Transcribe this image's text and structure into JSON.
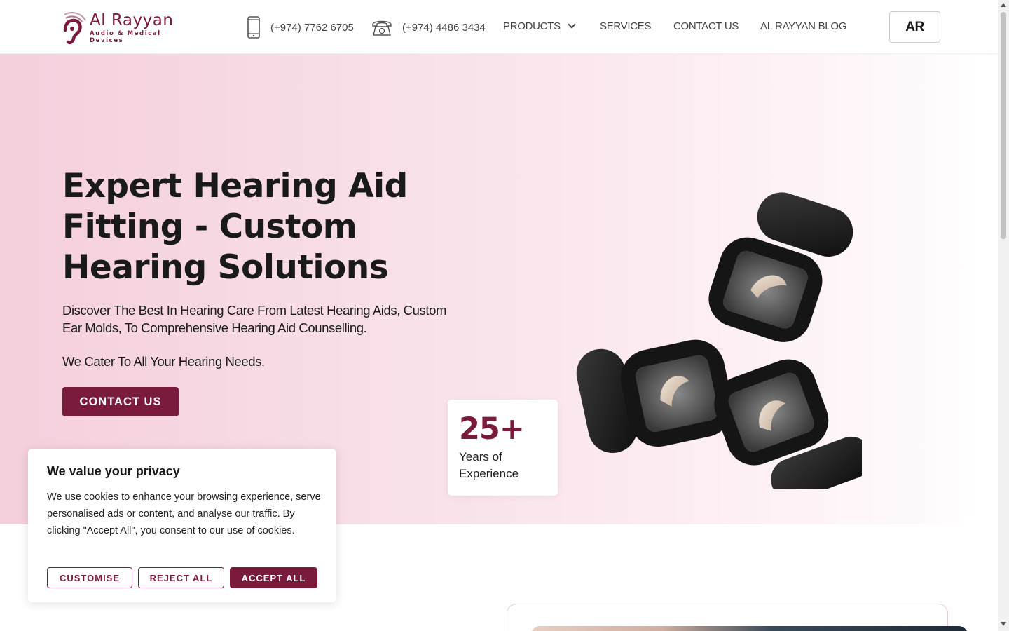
{
  "brand": {
    "name": "Al Rayyan",
    "tagline": "Audio & Medical Devices",
    "color": "#7a1a3d"
  },
  "header": {
    "phones": [
      {
        "icon": "mobile-phone-icon",
        "number": "(+974) 7762 6705"
      },
      {
        "icon": "telephone-icon",
        "number": "(+974) 4486 3434"
      }
    ],
    "nav": [
      {
        "label": "PRODUCTS",
        "has_dropdown": true
      },
      {
        "label": "SERVICES"
      },
      {
        "label": "CONTACT US"
      },
      {
        "label": "AL RAYYAN BLOG"
      }
    ],
    "language_button": "AR"
  },
  "hero": {
    "title": "Expert Hearing Aid Fitting - Custom Hearing Solutions",
    "description": "Discover The Best In Hearing Care From Latest Hearing Aids, Custom Ear Molds, To Comprehensive Hearing Aid Counselling.",
    "subtext": "We Cater To All Your Hearing Needs.",
    "cta": "CONTACT US",
    "stat": {
      "value": "25+",
      "label": "Years of Experience"
    },
    "gradient_start": "#f4cfdc"
  },
  "cookie_banner": {
    "title": "We value your privacy",
    "text": "We use cookies to enhance your browsing experience, serve personalised ads or content, and analyse our traffic. By clicking \"Accept All\", you consent to our use of cookies.",
    "buttons": {
      "customise": "CUSTOMISE",
      "reject": "REJECT ALL",
      "accept": "ACCEPT ALL"
    }
  }
}
